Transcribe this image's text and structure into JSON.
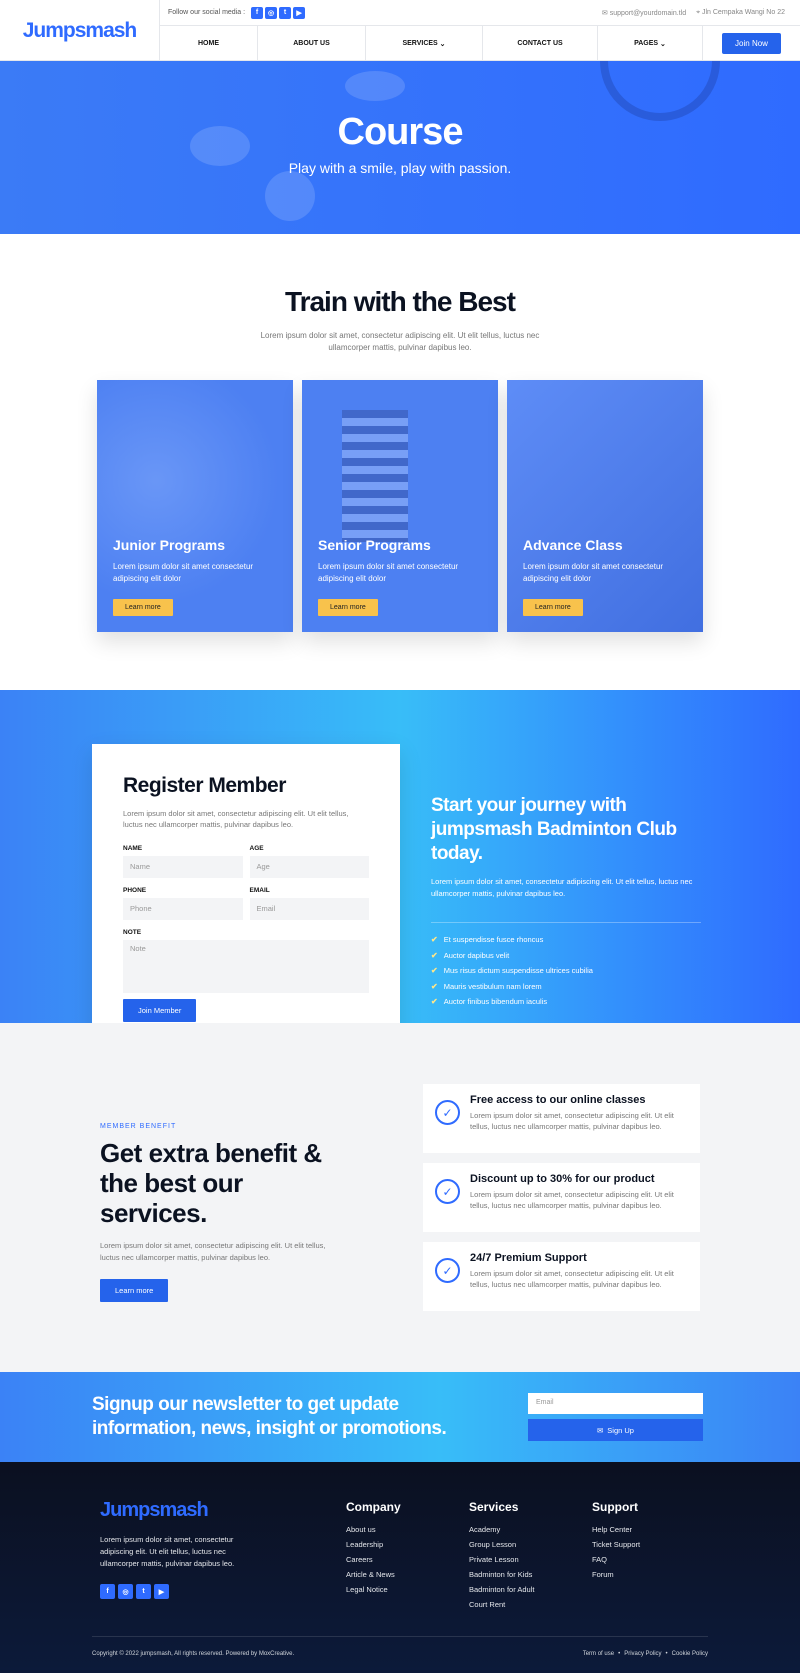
{
  "header": {
    "logo": "Jumpsmash",
    "follow": "Follow our social media :",
    "social_icons": [
      "facebook-icon",
      "instagram-icon",
      "twitter-icon",
      "youtube-icon"
    ],
    "email": "support@yourdomain.tld",
    "address": "Jln Cempaka Wangi No 22",
    "nav": [
      "HOME",
      "ABOUT US",
      "SERVICES",
      "CONTACT US",
      "PAGES"
    ],
    "join": "Join Now"
  },
  "hero": {
    "title": "Course",
    "subtitle": "Play with a smile, play with passion."
  },
  "train": {
    "title": "Train with the Best",
    "lead": "Lorem ipsum dolor sit amet, consectetur adipiscing elit. Ut elit tellus, luctus nec ullamcorper mattis, pulvinar dapibus leo.",
    "cards": [
      {
        "title": "Junior Programs",
        "desc": "Lorem ipsum dolor sit amet consectetur adipiscing elit dolor",
        "btn": "Learn more"
      },
      {
        "title": "Senior Programs",
        "desc": "Lorem ipsum dolor sit amet consectetur adipiscing elit dolor",
        "btn": "Learn more"
      },
      {
        "title": "Advance Class",
        "desc": "Lorem ipsum dolor sit amet consectetur adipiscing elit dolor",
        "btn": "Learn more"
      }
    ]
  },
  "register": {
    "title": "Register Member",
    "desc": "Lorem ipsum dolor sit amet, consectetur adipiscing elit. Ut elit tellus, luctus nec ullamcorper mattis, pulvinar dapibus leo.",
    "fields": {
      "name": {
        "label": "NAME",
        "placeholder": "Name"
      },
      "age": {
        "label": "AGE",
        "placeholder": "Age"
      },
      "phone": {
        "label": "PHONE",
        "placeholder": "Phone"
      },
      "email": {
        "label": "EMAIL",
        "placeholder": "Email"
      },
      "note": {
        "label": "NOTE",
        "placeholder": "Note"
      }
    },
    "submit": "Join Member",
    "side_title": "Start your journey with jumpsmash Badminton Club today.",
    "side_desc": "Lorem ipsum dolor sit amet, consectetur adipiscing elit. Ut elit tellus, luctus nec ullamcorper mattis, pulvinar dapibus leo.",
    "list": [
      "Et suspendisse fusce rhoncus",
      "Auctor dapibus velit",
      "Mus risus dictum suspendisse ultrices cubilia",
      "Mauris vestibulum nam lorem",
      "Auctor finibus bibendum iaculis"
    ]
  },
  "benefits": {
    "kicker": "MEMBER BENEFIT",
    "title": "Get extra benefit & the best our services.",
    "desc": "Lorem ipsum dolor sit amet, consectetur adipiscing elit. Ut elit tellus, luctus nec ullamcorper mattis, pulvinar dapibus leo.",
    "btn": "Learn more",
    "items": [
      {
        "title": "Free access to our online classes",
        "desc": "Lorem ipsum dolor sit amet, consectetur adipiscing elit. Ut elit tellus, luctus nec ullamcorper mattis, pulvinar dapibus leo."
      },
      {
        "title": "Discount up to 30% for our product",
        "desc": "Lorem ipsum dolor sit amet, consectetur adipiscing elit. Ut elit tellus, luctus nec ullamcorper mattis, pulvinar dapibus leo."
      },
      {
        "title": "24/7 Premium Support",
        "desc": "Lorem ipsum dolor sit amet, consectetur adipiscing elit. Ut elit tellus, luctus nec ullamcorper mattis, pulvinar dapibus leo."
      }
    ]
  },
  "newsletter": {
    "title": "Signup our newsletter to get update information, news, insight or promotions.",
    "placeholder": "Email",
    "btn": "Sign Up"
  },
  "footer": {
    "logo": "Jumpsmash",
    "desc": "Lorem ipsum dolor sit amet, consectetur adipiscing elit. Ut elit tellus, luctus nec ullamcorper mattis, pulvinar dapibus leo.",
    "company": {
      "title": "Company",
      "links": [
        "About us",
        "Leadership",
        "Careers",
        "Article & News",
        "Legal Notice"
      ]
    },
    "services": {
      "title": "Services",
      "links": [
        "Academy",
        "Group Lesson",
        "Private Lesson",
        "Badminton for Kids",
        "Badminton for Adult",
        "Court Rent"
      ]
    },
    "support": {
      "title": "Support",
      "links": [
        "Help Center",
        "Ticket Support",
        "FAQ",
        "Forum"
      ]
    },
    "copyright": "Copyright © 2022 jumpsmash, All rights reserved. Powered by MoxCreative.",
    "legal": [
      "Term of use",
      "Privacy Policy",
      "Cookie Policy"
    ]
  },
  "colors": {
    "brand": "#2f6bff",
    "accent": "#f8c24c",
    "dark": "#0b1020"
  }
}
